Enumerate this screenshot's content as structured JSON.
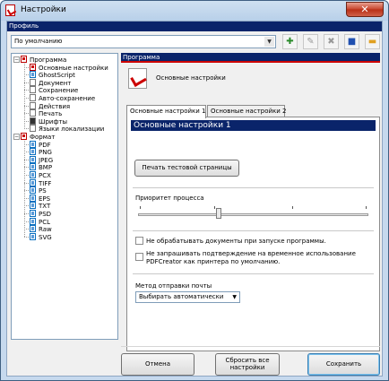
{
  "window": {
    "title": "Настройки",
    "close_glyph": "✕"
  },
  "profile": {
    "label": "Профиль",
    "selected": "По умолчанию"
  },
  "toolbar": {
    "items": [
      {
        "name": "add-profile-icon",
        "glyph": "✚",
        "color": "#2a8a2a"
      },
      {
        "name": "rename-profile-icon",
        "glyph": "✎",
        "color": "#999999"
      },
      {
        "name": "delete-profile-icon",
        "glyph": "✖",
        "color": "#999999"
      },
      {
        "name": "save-profile-icon",
        "glyph": "■",
        "color": "#2050b0"
      },
      {
        "name": "open-folder-icon",
        "glyph": "▬",
        "color": "#e0a020"
      }
    ]
  },
  "tree": {
    "program": {
      "label": "Программа",
      "children": [
        "Основные настройки",
        "GhostScript",
        "Документ",
        "Сохранение",
        "Авто-сохранение",
        "Действия",
        "Печать",
        "Шрифты",
        "Языки локализации"
      ]
    },
    "format": {
      "label": "Формат",
      "children": [
        "PDF",
        "PNG",
        "JPEG",
        "BMP",
        "PCX",
        "TIFF",
        "PS",
        "EPS",
        "TXT",
        "PSD",
        "PCL",
        "Raw",
        "SVG"
      ]
    }
  },
  "section": {
    "header": "Программа",
    "name": "Основные настройки"
  },
  "tabs": [
    "Основные настройки 1",
    "Основные настройки 2"
  ],
  "panel": {
    "title": "Основные настройки 1",
    "test_print_button": "Печать тестовой страницы",
    "priority_label": "Приоритет процесса",
    "priority_level_fraction": 0.35,
    "checkbox1": {
      "label": "Не обрабатывать документы при запуске программы.",
      "checked": false
    },
    "checkbox2": {
      "label_line1": "Не запрашивать подтверждение на временное использование",
      "label_line2": "PDFCreator как принтера по умолчанию.",
      "checked": false
    },
    "mail_method_label": "Метод отправки почты",
    "mail_method_value": "Выбирать автоматически"
  },
  "footer": {
    "cancel": "Отмена",
    "reset_line1": "Сбросить все",
    "reset_line2": "настройки",
    "save": "Сохранить"
  },
  "colors": {
    "header_bg": "#0a246a",
    "accent_red": "#cc0000"
  }
}
